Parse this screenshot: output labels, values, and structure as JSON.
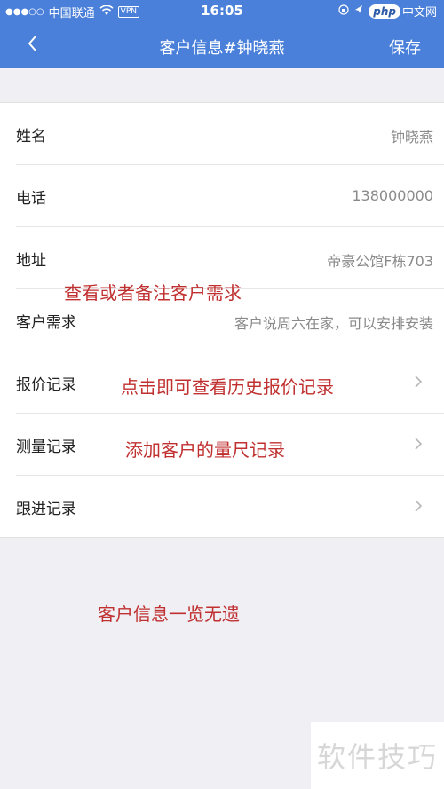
{
  "status_bar": {
    "signal": "●●●○○",
    "carrier": "中国联通",
    "vpn": "VPN",
    "time": "16:05",
    "logo_text": "php",
    "logo_suffix": "中文网"
  },
  "nav": {
    "back_icon": "chevron-left-icon",
    "title": "客户信息#钟晓燕",
    "save_label": "保存"
  },
  "rows": [
    {
      "label": "姓名",
      "value": "钟晓燕"
    },
    {
      "label": "电话",
      "value": "138000000"
    },
    {
      "label": "地址",
      "value": "帝豪公馆F栋703"
    },
    {
      "label": "客户需求",
      "value": "客户说周六在家，可以安排安装"
    },
    {
      "label": "报价记录",
      "value": ""
    },
    {
      "label": "测量记录",
      "value": ""
    },
    {
      "label": "跟进记录",
      "value": ""
    }
  ],
  "annotations": {
    "a1": "查看或者备注客户需求",
    "a2": "点击即可查看历史报价记录",
    "a3": "添加客户的量尺记录",
    "a4": "客户信息一览无遗"
  },
  "watermark": "软件技巧",
  "colors": {
    "nav_bg": "#4a80d9",
    "annotation": "#c03030"
  }
}
